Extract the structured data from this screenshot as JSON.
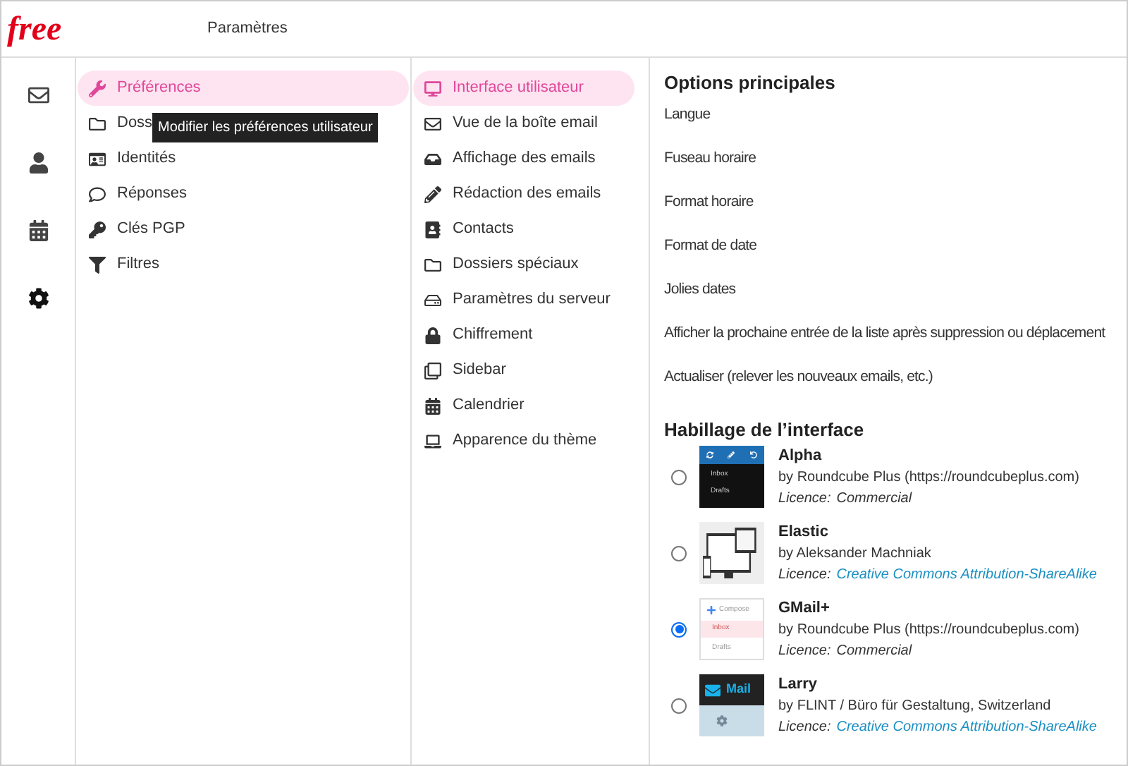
{
  "header": {
    "logo": "free",
    "title": "Paramètres"
  },
  "rail": [
    {
      "kind": "mail",
      "selected": false
    },
    {
      "kind": "contacts",
      "selected": false
    },
    {
      "kind": "calendar",
      "selected": false
    },
    {
      "kind": "settings",
      "selected": true
    }
  ],
  "sections": [
    {
      "kind": "wrench",
      "label": "Préférences",
      "selected": true
    },
    {
      "kind": "folder",
      "label": "Doss",
      "selected": false
    },
    {
      "kind": "idcard",
      "label": "Identités",
      "selected": false
    },
    {
      "kind": "comment",
      "label": "Réponses",
      "selected": false
    },
    {
      "kind": "key",
      "label": "Clés PGP",
      "selected": false
    },
    {
      "kind": "filter",
      "label": "Filtres",
      "selected": false
    }
  ],
  "tooltip": "Modifier les préférences utilisateur",
  "subsections": [
    {
      "kind": "desktop",
      "label": "Interface utilisateur",
      "selected": true
    },
    {
      "kind": "envelope",
      "label": "Vue de la boîte email",
      "selected": false
    },
    {
      "kind": "inbox",
      "label": "Affichage des emails",
      "selected": false
    },
    {
      "kind": "pencil",
      "label": "Rédaction des emails",
      "selected": false
    },
    {
      "kind": "addressbook",
      "label": "Contacts",
      "selected": false
    },
    {
      "kind": "folder",
      "label": "Dossiers spéciaux",
      "selected": false
    },
    {
      "kind": "hdd",
      "label": "Paramètres du serveur",
      "selected": false
    },
    {
      "kind": "lock",
      "label": "Chiffrement",
      "selected": false
    },
    {
      "kind": "clone",
      "label": "Sidebar",
      "selected": false
    },
    {
      "kind": "calendar",
      "label": "Calendrier",
      "selected": false
    },
    {
      "kind": "laptop",
      "label": "Apparence du thème",
      "selected": false
    }
  ],
  "main_options": {
    "title": "Options principales",
    "items": [
      "Langue",
      "Fuseau horaire",
      "Format horaire",
      "Format de date",
      "Jolies dates",
      "Afficher la prochaine entrée de la liste après suppression ou déplacement",
      "Actualiser (relever les nouveaux emails, etc.)"
    ]
  },
  "skins": {
    "title": "Habillage de l’interface",
    "items": [
      {
        "name": "Alpha",
        "author": "by Roundcube Plus (https://roundcubeplus.com)",
        "licence_label": "Licence:",
        "licence": "Commercial",
        "licence_link": false,
        "selected": false,
        "thumbnail": {
          "kind": "alpha",
          "texts": [
            "Inbox",
            "Drafts"
          ]
        }
      },
      {
        "name": "Elastic",
        "author": "by Aleksander Machniak",
        "licence_label": "Licence:",
        "licence": "Creative Commons Attribution-ShareAlike",
        "licence_link": true,
        "selected": false,
        "thumbnail": {
          "kind": "elastic"
        }
      },
      {
        "name": "GMail+",
        "author": "by Roundcube Plus (https://roundcubeplus.com)",
        "licence_label": "Licence:",
        "licence": "Commercial",
        "licence_link": false,
        "selected": true,
        "thumbnail": {
          "kind": "gmail",
          "texts": [
            "Compose",
            "Inbox",
            "Drafts"
          ]
        }
      },
      {
        "name": "Larry",
        "author": "by FLINT / Büro für Gestaltung, Switzerland",
        "licence_label": "Licence:",
        "licence": "Creative Commons Attribution-ShareAlike",
        "licence_link": true,
        "selected": false,
        "thumbnail": {
          "kind": "larry",
          "texts": [
            "Mail"
          ]
        }
      }
    ]
  }
}
